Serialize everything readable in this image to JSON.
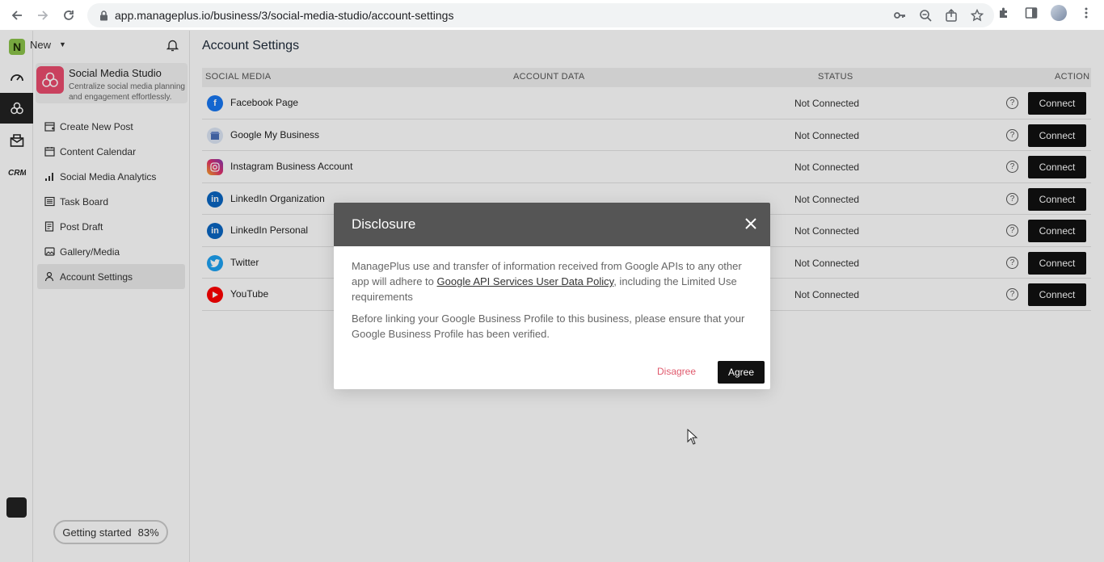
{
  "browser": {
    "url": "app.manageplus.io/business/3/social-media-studio/account-settings"
  },
  "rail": {
    "logo_letter": "N"
  },
  "sidebar": {
    "new_label": "New",
    "app_title": "Social Media Studio",
    "app_description": "Centralize social media planning and engagement effortlessly.",
    "menu": [
      {
        "label": "Create New Post",
        "icon": "calendar-plus-icon"
      },
      {
        "label": "Content Calendar",
        "icon": "calendar-icon"
      },
      {
        "label": "Social Media Analytics",
        "icon": "bar-chart-icon"
      },
      {
        "label": "Task Board",
        "icon": "list-icon"
      },
      {
        "label": "Post Draft",
        "icon": "document-icon"
      },
      {
        "label": "Gallery/Media",
        "icon": "gallery-icon"
      },
      {
        "label": "Account Settings",
        "icon": "user-icon",
        "active": true
      }
    ],
    "getting_started_label": "Getting started",
    "getting_started_percent": "83%"
  },
  "main": {
    "title": "Account Settings",
    "columns": [
      "SOCIAL MEDIA",
      "ACCOUNT DATA",
      "STATUS",
      "ACTION"
    ],
    "rows": [
      {
        "name": "Facebook Page",
        "status": "Not Connected",
        "action": "Connect",
        "icon": "facebook-icon",
        "color": "#1877f2"
      },
      {
        "name": "Google My Business",
        "status": "Not Connected",
        "action": "Connect",
        "icon": "google-my-business-icon",
        "color": "#8ab4f8"
      },
      {
        "name": "Instagram Business Account",
        "status": "Not Connected",
        "action": "Connect",
        "icon": "instagram-icon",
        "color": "#e1306c"
      },
      {
        "name": "LinkedIn Organization",
        "status": "Not Connected",
        "action": "Connect",
        "icon": "linkedin-icon",
        "color": "#0a66c2"
      },
      {
        "name": "LinkedIn Personal",
        "status": "Not Connected",
        "action": "Connect",
        "icon": "linkedin-icon",
        "color": "#0a66c2"
      },
      {
        "name": "Twitter",
        "status": "Not Connected",
        "action": "Connect",
        "icon": "twitter-icon",
        "color": "#1da1f2"
      },
      {
        "name": "YouTube",
        "status": "Not Connected",
        "action": "Connect",
        "icon": "youtube-icon",
        "color": "#ff0000"
      }
    ]
  },
  "modal": {
    "title": "Disclosure",
    "para1_before": "ManagePlus use and transfer of information received from Google APIs to any other app will adhere to ",
    "para1_link": "Google API Services User Data Policy",
    "para1_after": ", including the Limited Use requirements",
    "para2": "Before linking your Google Business Profile to this business, please ensure that your Google Business Profile has been verified.",
    "disagree_label": "Disagree",
    "agree_label": "Agree"
  }
}
